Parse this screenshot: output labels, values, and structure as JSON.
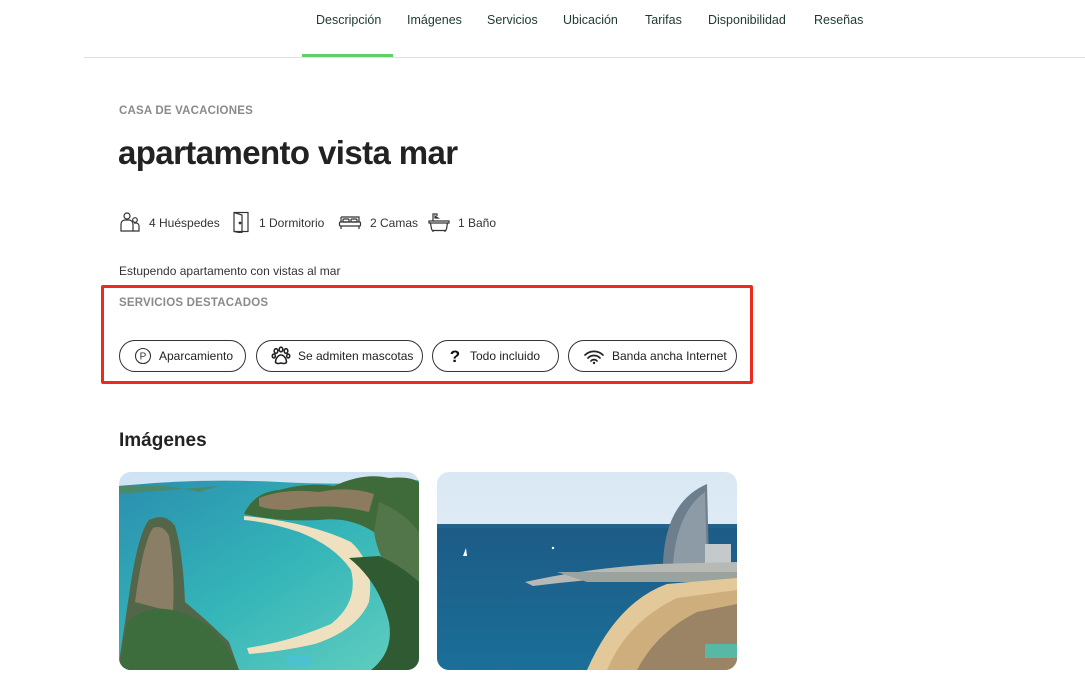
{
  "nav": {
    "tabs": [
      "Descripción",
      "Imágenes",
      "Servicios",
      "Ubicación",
      "Tarifas",
      "Disponibilidad",
      "Reseñas"
    ],
    "active": "Descripción",
    "accent_color": "#5fd068"
  },
  "listing": {
    "type_label": "CASA DE VACACIONES",
    "title": "apartamento vista mar",
    "facts": [
      {
        "icon": "guests-icon",
        "label": "4 Huéspedes"
      },
      {
        "icon": "door-icon",
        "label": "1 Dormitorio"
      },
      {
        "icon": "bed-icon",
        "label": "2 Camas"
      },
      {
        "icon": "bathtub-icon",
        "label": "1 Baño"
      }
    ],
    "description": "Estupendo apartamento con vistas al mar"
  },
  "featured": {
    "title": "SERVICIOS DESTACADOS",
    "highlight_color": "#ee2a1e",
    "chips": [
      {
        "icon": "parking-icon",
        "label": "Aparcamiento"
      },
      {
        "icon": "paw-icon",
        "label": "Se admiten mascotas"
      },
      {
        "icon": "question-icon",
        "label": "Todo incluido"
      },
      {
        "icon": "wifi-icon",
        "label": "Banda ancha Internet"
      }
    ]
  },
  "images": {
    "title": "Imágenes",
    "photos": [
      {
        "name": "tropical-bay-photo"
      },
      {
        "name": "city-beach-photo"
      }
    ]
  }
}
